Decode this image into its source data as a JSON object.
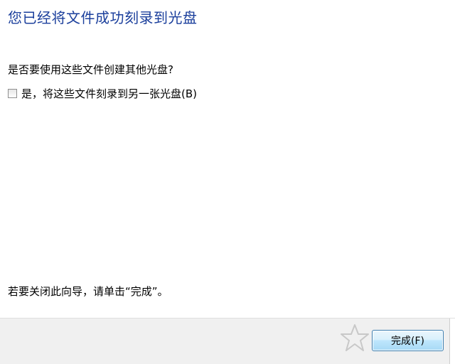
{
  "wizard": {
    "title": "您已经将文件成功刻录到光盘",
    "question": "是否要使用这些文件创建其他光盘?",
    "option": {
      "label": "是，将这些文件刻录到另一张光盘(B)",
      "checked": false
    },
    "closing_hint": "若要关闭此向导，请单击“完成”。"
  },
  "footer": {
    "finish_label": "完成(F)"
  },
  "icons": {
    "watermark": "star-icon"
  },
  "colors": {
    "title": "#1b3f9c",
    "footer_bg": "#f0f0f0",
    "button_border": "#3c7fb1"
  }
}
